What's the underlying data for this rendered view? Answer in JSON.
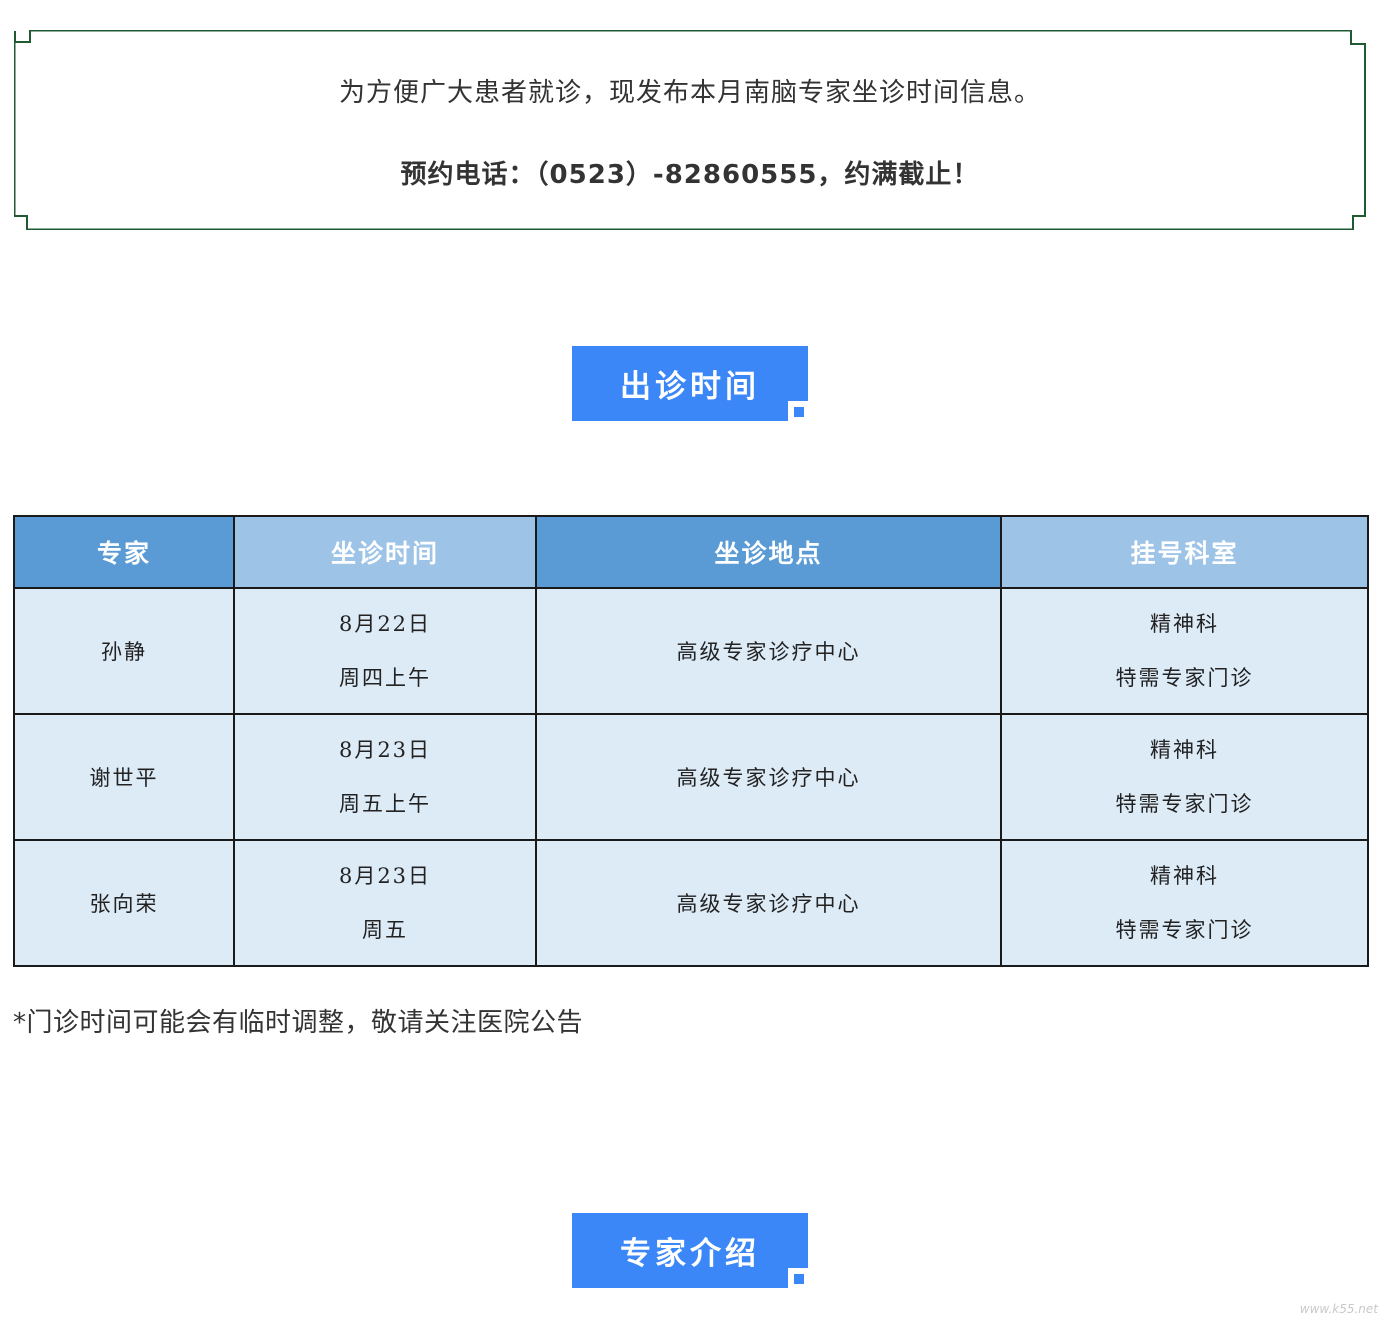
{
  "notice": {
    "line1": "为方便广大患者就诊，现发布本月南脑专家坐诊时间信息。",
    "line2": "预约电话：（0523）-82860555，约满截止！"
  },
  "section_schedule": {
    "title": "出诊时间"
  },
  "table": {
    "headers": [
      "专家",
      "坐诊时间",
      "坐诊地点",
      "挂号科室"
    ],
    "rows": [
      {
        "expert": "孙静",
        "date": "8月22日",
        "period": "周四上午",
        "location": "高级专家诊疗中心",
        "dept1": "精神科",
        "dept2": "特需专家门诊"
      },
      {
        "expert": "谢世平",
        "date": "8月23日",
        "period": "周五上午",
        "location": "高级专家诊疗中心",
        "dept1": "精神科",
        "dept2": "特需专家门诊"
      },
      {
        "expert": "张向荣",
        "date": "8月23日",
        "period": "周五",
        "location": "高级专家诊疗中心",
        "dept1": "精神科",
        "dept2": "特需专家门诊"
      }
    ]
  },
  "footnote": "*门诊时间可能会有临时调整，敬请关注医院公告",
  "section_experts": {
    "title": "专家介绍"
  },
  "watermark": "www.k55.net",
  "colors": {
    "accent": "#3b87f7",
    "header_dark": "#5b9bd5",
    "header_light": "#9dc3e6",
    "cell_bg": "#ddebf7",
    "frame": "#1f5a32"
  }
}
